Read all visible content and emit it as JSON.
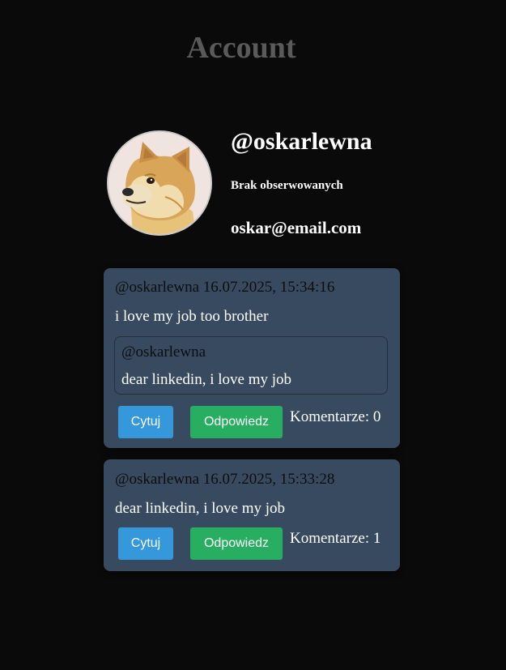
{
  "page": {
    "title": "Account"
  },
  "profile": {
    "username": "@oskarlewna",
    "following_status": "Brak obserwowanych",
    "email": "oskar@email.com",
    "avatar_icon": "doge-avatar"
  },
  "colors": {
    "background": "#0a0a0a",
    "card": "#384a60",
    "quote_button": "#3498db",
    "reply_button": "#27ae60"
  },
  "posts": [
    {
      "author": "@oskarlewna",
      "timestamp": "16.07.2025, 15:34:16",
      "meta": "@oskarlewna 16.07.2025, 15:34:16",
      "text": "i love my job too brother",
      "quoted": {
        "author": "@oskarlewna",
        "text": "dear linkedin, i love my job"
      },
      "quote_label": "Cytuj",
      "reply_label": "Odpowiedz",
      "comments_label": "Komentarze: 0"
    },
    {
      "author": "@oskarlewna",
      "timestamp": "16.07.2025, 15:33:28",
      "meta": "@oskarlewna 16.07.2025, 15:33:28",
      "text": "dear linkedin, i love my job",
      "quote_label": "Cytuj",
      "reply_label": "Odpowiedz",
      "comments_label": "Komentarze: 1"
    }
  ]
}
